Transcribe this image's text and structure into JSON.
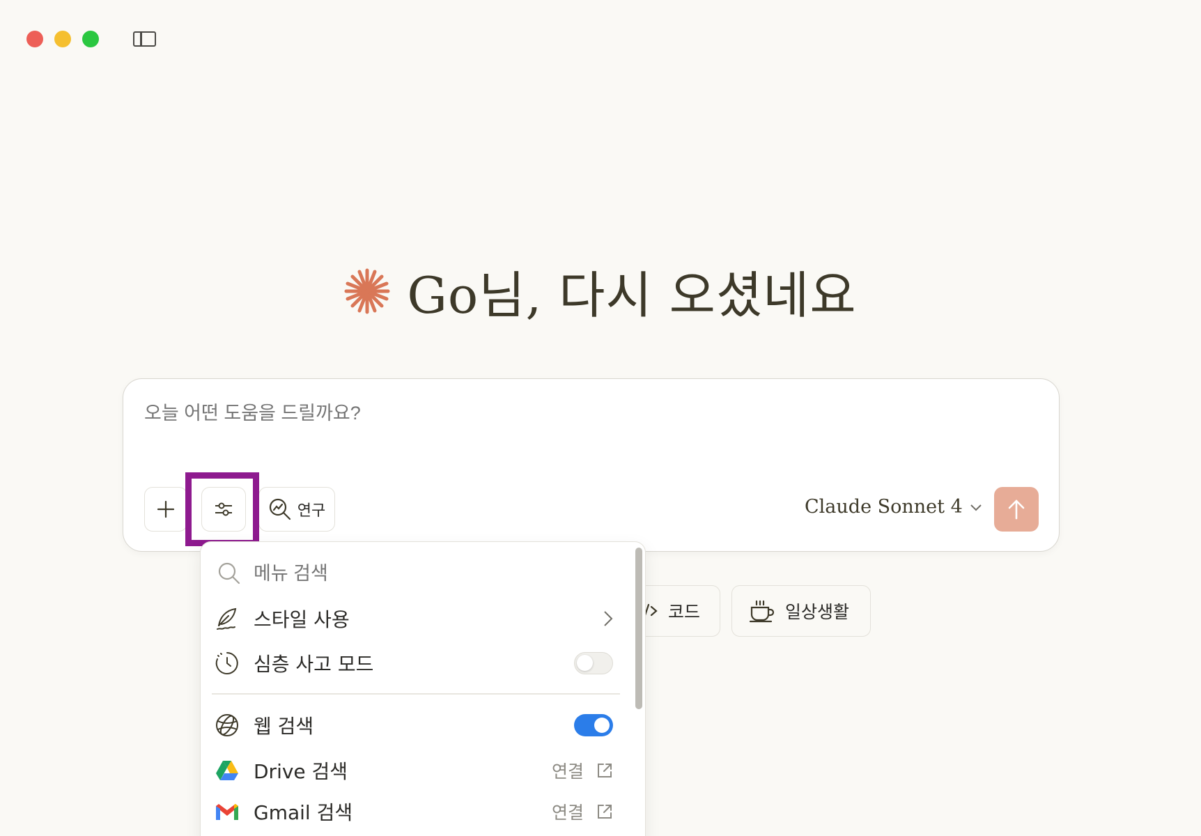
{
  "greeting": {
    "text": "Go님, 다시 오셨네요"
  },
  "composer": {
    "placeholder": "오늘 어떤 도움을 드릴까요?",
    "research_label": "연구",
    "model_label": "Claude Sonnet 4"
  },
  "chips": [
    {
      "label": "코드",
      "icon": "code-icon"
    },
    {
      "label": "일상생활",
      "icon": "coffee-cup-icon"
    }
  ],
  "menu": {
    "search_placeholder": "메뉴 검색",
    "items": [
      {
        "label": "스타일 사용",
        "icon": "feather-pen-icon",
        "control": "chevron"
      },
      {
        "label": "심층 사고 모드",
        "icon": "clock-icon",
        "control": "toggle",
        "toggle_on": false
      },
      {
        "label": "웹 검색",
        "icon": "globe-icon",
        "control": "toggle",
        "toggle_on": true
      },
      {
        "label": "Drive 검색",
        "icon": "google-drive-icon",
        "control": "connect",
        "connect_label": "연결"
      },
      {
        "label": "Gmail 검색",
        "icon": "gmail-icon",
        "control": "connect",
        "connect_label": "연결"
      }
    ]
  },
  "colors": {
    "accent": "#d97757",
    "highlight": "#8e1a8f",
    "toggle_on": "#2b7de9",
    "send_button": "#e7ac97"
  }
}
